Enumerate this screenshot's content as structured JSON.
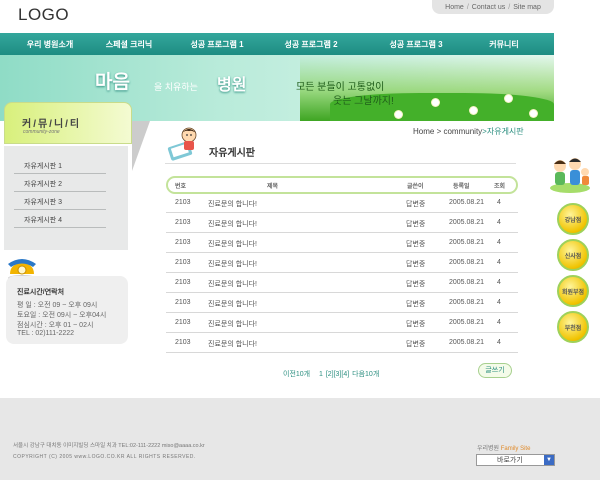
{
  "header": {
    "logo": "LOGO",
    "top_links": [
      "Home",
      "Contact us",
      "Site map"
    ]
  },
  "nav": {
    "items": [
      "우리 병원소개",
      "스페셜 크리닉",
      "성공 프로그램 1",
      "성공 프로그램 2",
      "성공 프로그램 3",
      "커뮤니티"
    ]
  },
  "banner": {
    "big_text_1": "마음",
    "small_text": "을 치유하는",
    "big_text_2": "병원",
    "slogan_line_1": "모든 분들이 고통없이",
    "slogan_line_2": "웃는 그날까지!"
  },
  "sidebar": {
    "title": "커/뮤/니/티",
    "subtitle": "community-zone",
    "items": [
      "자유게시판 1",
      "자유게시판 2",
      "자유게시판 3",
      "자유게시판 4"
    ],
    "hours": {
      "title": "진료시간/연락처",
      "lines": [
        "평 일 : 오전 09 ~ 오후 09시",
        "토요일 : 오전 09시 ~ 오후04시",
        "점심시간 : 오후 01 ~ 02시",
        "TEL : 02)111-2222"
      ]
    }
  },
  "content": {
    "breadcrumb": {
      "home": "Home",
      "sep1": ">",
      "community": "community",
      "sep2": ">",
      "current": "자유게시판"
    },
    "page_title": "자유게시판",
    "table": {
      "headers": [
        "번호",
        "제목",
        "글쓴이",
        "등록일",
        "조회"
      ],
      "rows": [
        [
          "2103",
          "진료문의 합니다!",
          "답변중",
          "2005.08.21",
          "4"
        ],
        [
          "2103",
          "진료문의 합니다!",
          "답변중",
          "2005.08.21",
          "4"
        ],
        [
          "2103",
          "진료문의 합니다!",
          "답변중",
          "2005.08.21",
          "4"
        ],
        [
          "2103",
          "진료문의 합니다!",
          "답변중",
          "2005.08.21",
          "4"
        ],
        [
          "2103",
          "진료문의 합니다!",
          "답변중",
          "2005.08.21",
          "4"
        ],
        [
          "2103",
          "진료문의 합니다!",
          "답변중",
          "2005.08.21",
          "4"
        ],
        [
          "2103",
          "진료문의 합니다!",
          "답변중",
          "2005.08.21",
          "4"
        ],
        [
          "2103",
          "진료문의 합니다!",
          "답변중",
          "2005.08.21",
          "4"
        ]
      ]
    },
    "pager": {
      "prev": "이전10개",
      "pages": [
        "1",
        "[2]",
        "[3]",
        "[4]"
      ],
      "next": "다음10개"
    },
    "write_button": "글쓰기"
  },
  "quick_menu": {
    "items": [
      "강남점",
      "신사점",
      "회원부점",
      "부천점"
    ]
  },
  "footer": {
    "address": "서울시 강남구 대치동 이미지빌딩 스마일 치과  TEL:02-111-2222  miso@aaaa.co.kr",
    "copyright": "COPYRIGHT (C) 2005 www.LOGO.CO.KR  ALL RIGHTS RESERVED.",
    "family_site_prefix": "우리병원",
    "family_site_label": "Family Site",
    "select_value": "바로가기"
  },
  "colors": {
    "nav_teal": "#1e8c82",
    "accent_green": "#c3e39a",
    "banner_mint": "#8fdcc6",
    "lime": "#d8f07c"
  }
}
